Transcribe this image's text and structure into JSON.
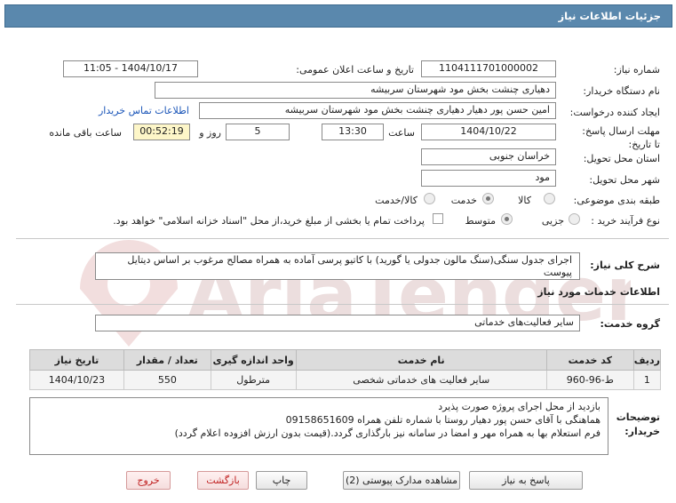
{
  "title": "جزئیات اطلاعات نیاز",
  "labels": {
    "need_number": "شماره نیاز:",
    "announce_datetime": "تاریخ و ساعت اعلان عمومی:",
    "buyer_org": "نام دستگاه خریدار:",
    "requester": "ایجاد کننده درخواست:",
    "contact_link": "اطلاعات تماس خریدار",
    "deadline": "مهلت ارسال پاسخ: تا تاریخ:",
    "time": "ساعت",
    "day_and": "روز و",
    "remaining": "ساعت باقی مانده",
    "province": "استان محل تحویل:",
    "city": "شهر محل تحویل:",
    "category": "طبقه بندی موضوعی:",
    "process_type": "نوع فرآیند خرید :",
    "general_desc": "شرح کلی نیاز:",
    "services_info": "اطلاعات خدمات مورد نیاز",
    "service_group": "گروه خدمت:",
    "buyer_notes": "توضیحات خریدار:"
  },
  "values": {
    "need_number": "1104111701000002",
    "announce_datetime": "1404/10/17 - 11:05",
    "buyer_org": "دهیاری چنشت بخش مود شهرستان سربیشه",
    "requester": "امین حسن پور دهیار دهیاری چنشت بخش مود شهرستان سربیشه",
    "deadline_date": "1404/10/22",
    "deadline_time": "13:30",
    "days": "5",
    "remaining_time": "00:52:19",
    "province": "خراسان جنوبی",
    "city": "مود",
    "general_desc": "اجرای جدول سنگی(سنگ مالون جدولی یا گورید)  با کاتیو پرسی آماده به همراه مصالح مرغوب بر اساس دیتایل پیوست",
    "service_group": "سایر فعالیت‌های خدماتی"
  },
  "category_options": [
    {
      "label": "کالا",
      "selected": false
    },
    {
      "label": "خدمت",
      "selected": true
    },
    {
      "label": "کالا/خدمت",
      "selected": false
    }
  ],
  "process_options": [
    {
      "label": "جزیی",
      "selected": false
    },
    {
      "label": "متوسط",
      "selected": true
    }
  ],
  "treasury_note": "پرداخت تمام یا بخشی از مبلغ خرید،از محل \"اسناد خزانه اسلامی\" خواهد بود.",
  "table": {
    "headers": [
      "ردیف",
      "کد خدمت",
      "نام خدمت",
      "واحد اندازه گیری",
      "تعداد / مقدار",
      "تاریخ نیاز"
    ],
    "rows": [
      [
        "1",
        "ط-96-960",
        "سایر فعالیت های خدماتی شخصی",
        "مترطول",
        "550",
        "1404/10/23"
      ]
    ]
  },
  "notes": [
    "بازدید از محل اجرای پروژه صورت پذیرد",
    "هماهنگی با آقای حسن پور دهیار روستا با شماره تلفن همراه 09158651609",
    "فرم استعلام بها به همراه مهر و امضا در سامانه نیز بارگذاری گردد.(قیمت بدون ارزش افزوده اعلام گردد)"
  ],
  "buttons": {
    "reply": "پاسخ به نیاز",
    "view_docs": "مشاهده مدارک پیوستی (2)",
    "print": "چاپ",
    "back": "بازگشت",
    "exit": "خروج"
  },
  "watermark_text": "AriaTender.net"
}
